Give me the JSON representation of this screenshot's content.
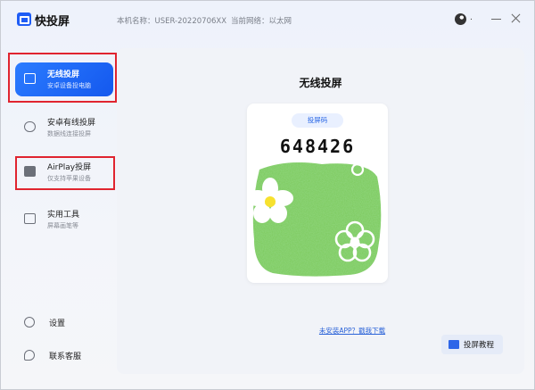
{
  "window": {
    "app_name": "快投屏",
    "host_label": "本机名称：USER-20220706XX",
    "network_label": "当前网络：以太网",
    "user_dot": "."
  },
  "sidebar": {
    "items": [
      {
        "label": "无线投屏",
        "sub": "安卓设备投电脑",
        "icon": "wireless-cast-icon",
        "active": true
      },
      {
        "label": "安卓有线投屏",
        "sub": "数据线连接投屏",
        "icon": "usb-cable-icon",
        "active": false
      },
      {
        "label": "AirPlay投屏",
        "sub": "仅支持苹果设备",
        "icon": "airplay-icon",
        "active": false
      },
      {
        "label": "实用工具",
        "sub": "屏幕画笔等",
        "icon": "toolbox-icon",
        "active": false
      }
    ],
    "bottom": [
      {
        "label": "设置",
        "icon": "gear-icon"
      },
      {
        "label": "联系客服",
        "icon": "chat-icon"
      }
    ]
  },
  "main": {
    "title": "无线投屏",
    "code_tag": "投屏码",
    "code": "648426",
    "download_link": "未安装APP？戳我下载",
    "tutorial_button": "投屏教程"
  },
  "colors": {
    "accent": "#1f5df5",
    "annotation_red": "#e0242f",
    "art_green": "#7cc95a"
  }
}
